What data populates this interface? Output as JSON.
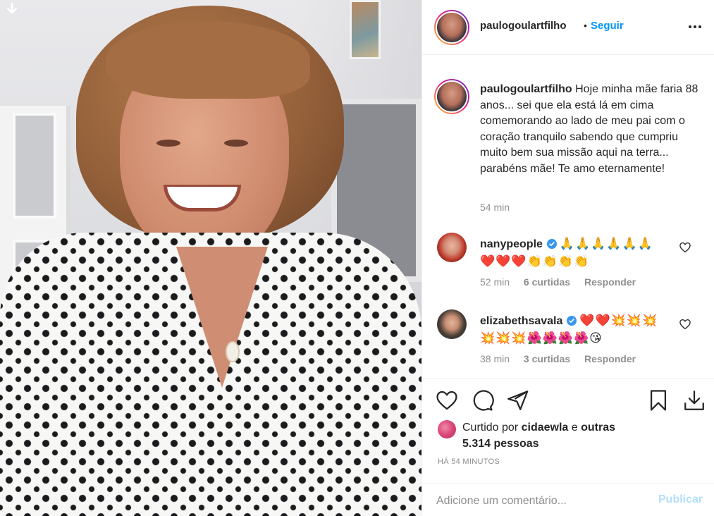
{
  "post": {
    "image_alt": "",
    "author": "paulogoulartfilho",
    "follow_label": "Seguir",
    "separator": "•",
    "caption": "Hoje minha mãe faria 88 anos... sei que ela está lá em cima comemorando ao lado de meu pai com o coração tranquilo sabendo que cumpriu muito bem sua missão aqui na terra... parabéns mãe! Te amo eternamente!",
    "caption_time": "54 min"
  },
  "comments": [
    {
      "username": "nanypeople",
      "verified": true,
      "text": "🙏🙏🙏🙏🙏🙏 ❤️❤️❤️👏👏👏👏",
      "time": "52 min",
      "likes": "6 curtidas",
      "reply": "Responder"
    },
    {
      "username": "elizabethsavala",
      "verified": true,
      "text": "❤️❤️💥💥💥 💥💥💥🌺🌺🌺🌺😘",
      "time": "38 min",
      "likes": "3 curtidas",
      "reply": "Responder"
    }
  ],
  "actions": {
    "like_icon": "heart-outline",
    "comment_icon": "speech-bubble",
    "share_icon": "paper-plane",
    "save_icon": "bookmark",
    "download_icon": "download-arrow"
  },
  "likes": {
    "prefix": "Curtido por",
    "by": "cidaewla",
    "conj": "e",
    "others": "outras 5.314 pessoas"
  },
  "timestamp": "HÁ 54 MINUTOS",
  "comment_input": {
    "placeholder": "Adicione um comentário...",
    "publish_label": "Publicar"
  },
  "colors": {
    "accent": "#0095f6",
    "publish_disabled": "#b2dffc",
    "muted": "#8e8e8e",
    "text": "#262626",
    "verified": "#3897f0"
  }
}
